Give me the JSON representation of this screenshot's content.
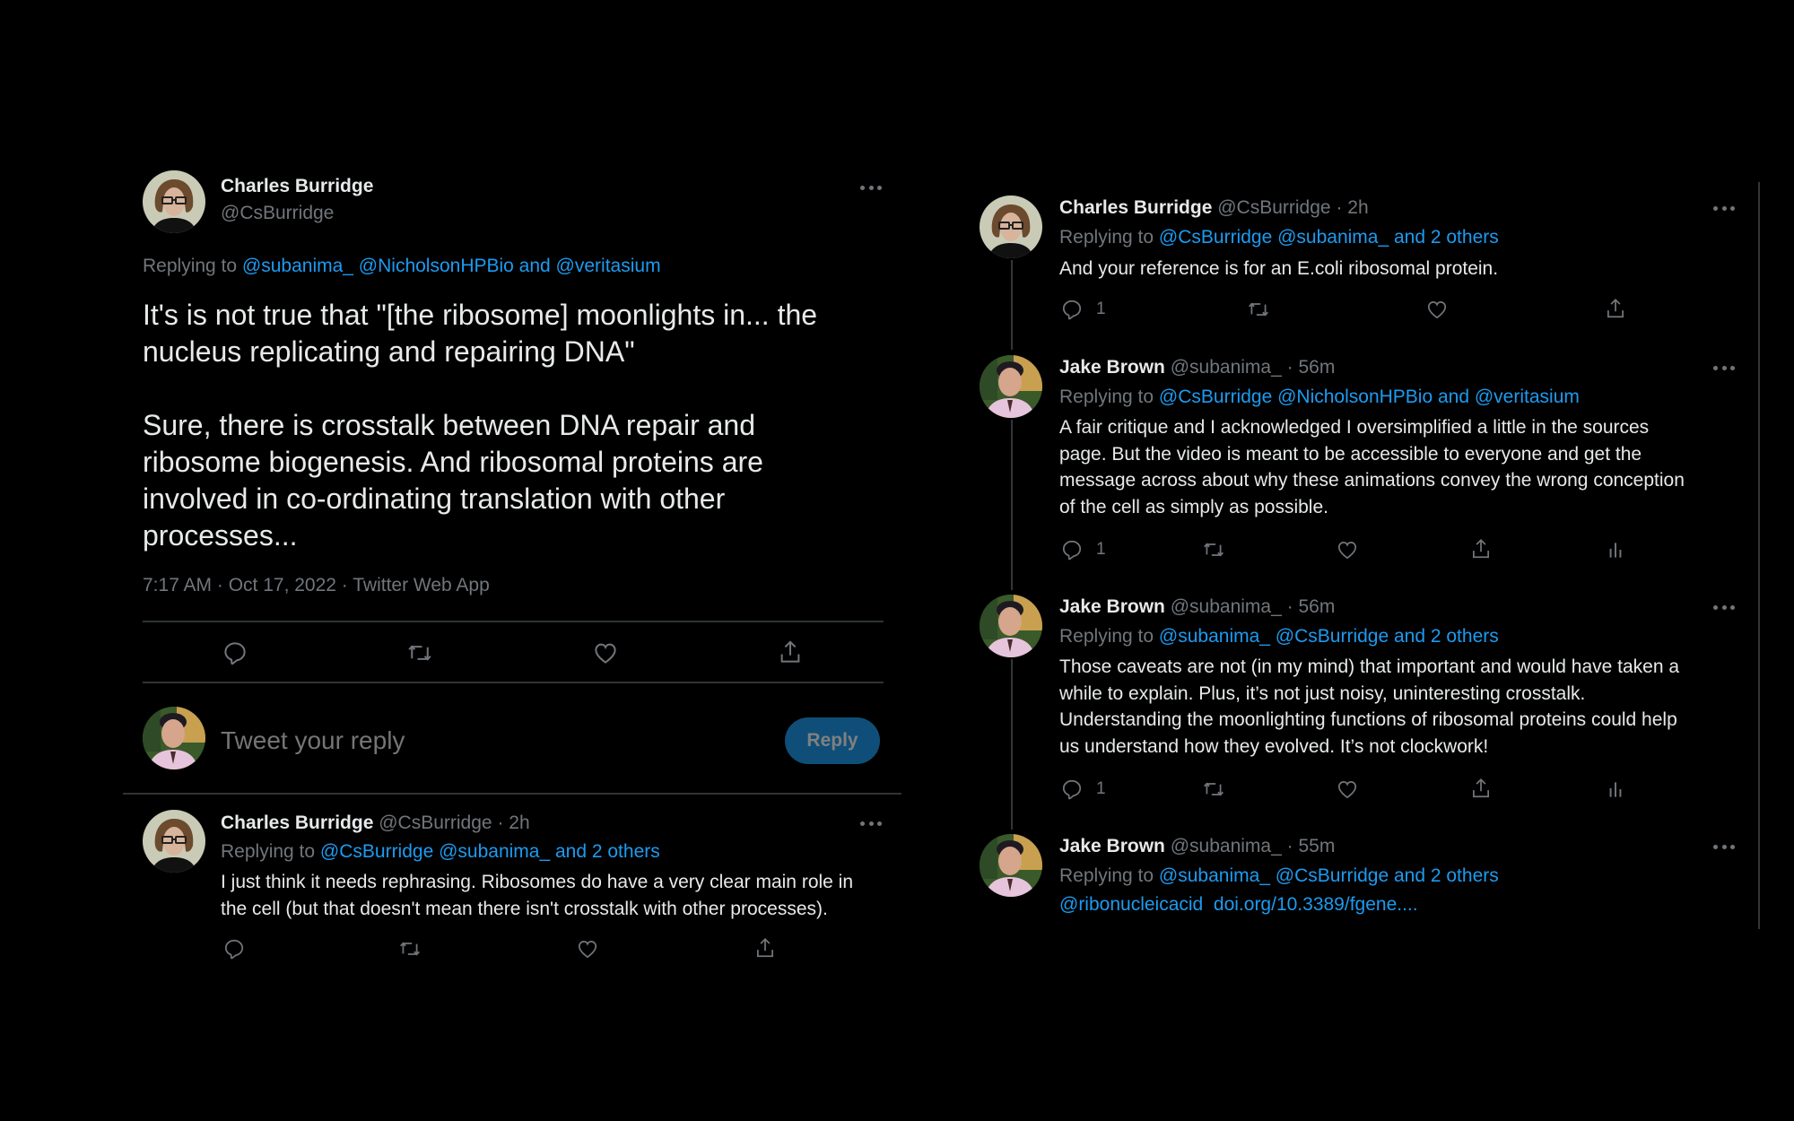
{
  "left": {
    "main_tweet": {
      "author_name": "Charles Burridge",
      "author_handle": "@CsBurridge",
      "replying_prefix": "Replying to",
      "replying_to": "@subanima_ @NicholsonHPBio and @veritasium",
      "body_lines": [
        "It's is not true that \"[the ribosome] moonlights in... the",
        "nucleus replicating and repairing DNA\"",
        "Sure, there is crosstalk between DNA repair and",
        "ribosome biogenesis. And ribosomal proteins are",
        "involved in co-ordinating translation with other",
        "processes..."
      ],
      "meta": "7:17 AM · Oct 17, 2022 · Twitter Web App",
      "actions": [
        "reply-icon",
        "retweet-icon",
        "like-icon",
        "share-icon"
      ]
    },
    "composer": {
      "placeholder": "Tweet your reply",
      "reply_button": "Reply"
    },
    "reply_tweet": {
      "author_name": "Charles Burridge",
      "author_handle": "@CsBurridge",
      "time": "· 2h",
      "replying_prefix": "Replying to",
      "replying_to": "@CsBurridge @subanima_ and 2 others",
      "body_lines": [
        "I just think it needs rephrasing. Ribosomes do have a very clear main role in",
        "the cell (but that doesn't mean there isn't crosstalk with other processes)."
      ]
    }
  },
  "right": {
    "tweets": [
      {
        "author_name": "Charles Burridge",
        "author_handle": "@CsBurridge",
        "time": "· 2h",
        "replying_prefix": "Replying to",
        "replying_to": "@CsBurridge @subanima_ and 2 others",
        "body_lines": [
          "And your reference is for an E.coli ribosomal protein."
        ],
        "reply_count": "1"
      },
      {
        "author_name": "Jake Brown",
        "author_handle": "@subanima_",
        "time": "· 56m",
        "replying_prefix": "Replying to",
        "replying_to": "@CsBurridge @NicholsonHPBio and @veritasium",
        "body_lines": [
          "A fair critique and I acknowledged I oversimplified a little in the sources",
          "page. But the video is meant to be accessible to everyone and get the",
          "message across about why these animations convey the wrong conception",
          "of the cell as simply as possible."
        ],
        "reply_count": "1"
      },
      {
        "author_name": "Jake Brown",
        "author_handle": "@subanima_",
        "time": "· 56m",
        "replying_prefix": "Replying to",
        "replying_to": "@subanima_ @CsBurridge and 2 others",
        "body_lines": [
          "Those caveats are not (in my mind) that important and would have taken a",
          "while to explain. Plus, it’s not just noisy, uninteresting crosstalk.",
          "Understanding the moonlighting functions of ribosomal proteins could help",
          "us understand how they evolved. It’s not clockwork!"
        ],
        "reply_count": "1"
      },
      {
        "author_name": "Jake Brown",
        "author_handle": "@subanima_",
        "time": "· 55m",
        "replying_prefix": "Replying to",
        "replying_to": "@subanima_ @CsBurridge and 2 others",
        "body_links": [
          "@ribonucleicacid",
          "doi.org/10.3389/fgene...."
        ]
      }
    ]
  },
  "colors": {
    "background": "#000000",
    "text": "#e7e9ea",
    "muted": "#71767b",
    "link": "#1d9bf0",
    "reply_button_bg": "#0f4e78",
    "divider": "#2f3336"
  }
}
